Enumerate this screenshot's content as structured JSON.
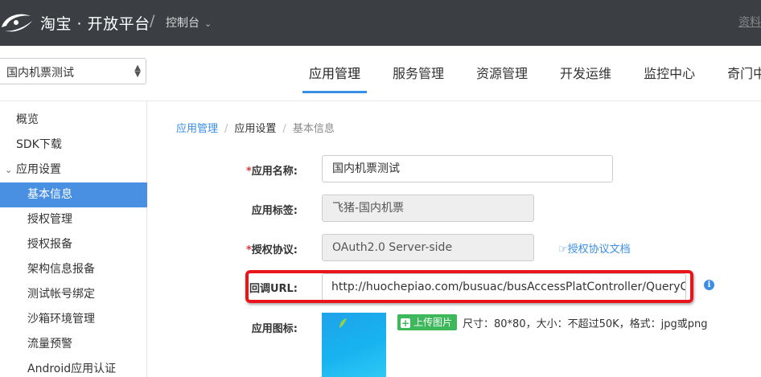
{
  "topbar": {
    "brand": "淘宝 · 开放平台",
    "separator": "/",
    "console": "控制台",
    "right_link": "资料"
  },
  "app_selector": {
    "value": "国内机票测试"
  },
  "nav": {
    "tabs": [
      {
        "label": "应用管理",
        "active": true
      },
      {
        "label": "服务管理",
        "active": false
      },
      {
        "label": "资源管理",
        "active": false
      },
      {
        "label": "开发运维",
        "active": false
      },
      {
        "label": "监控中心",
        "active": false
      },
      {
        "label": "奇门中",
        "active": false
      }
    ]
  },
  "sidebar": {
    "items": [
      {
        "label": "概览",
        "level": "top"
      },
      {
        "label": "SDK下载",
        "level": "top"
      },
      {
        "label": "应用设置",
        "level": "top",
        "expanded": true
      },
      {
        "label": "基本信息",
        "level": "sub",
        "active": true
      },
      {
        "label": "授权管理",
        "level": "sub"
      },
      {
        "label": "授权报备",
        "level": "sub"
      },
      {
        "label": "架构信息报备",
        "level": "sub"
      },
      {
        "label": "测试帐号绑定",
        "level": "sub"
      },
      {
        "label": "沙箱环境管理",
        "level": "sub"
      },
      {
        "label": "流量预警",
        "level": "sub"
      },
      {
        "label": "Android应用认证",
        "level": "sub"
      }
    ]
  },
  "breadcrumb": {
    "items": [
      "应用管理",
      "应用设置",
      "基本信息"
    ],
    "sep": "/"
  },
  "form": {
    "app_name": {
      "required_mark": "*",
      "label": "应用名称:",
      "value": "国内机票测试"
    },
    "app_tag": {
      "label": "应用标签:",
      "value": "飞猪-国内机票"
    },
    "auth_protocol": {
      "required_mark": "*",
      "label": "授权协议:",
      "value": "OAuth2.0 Server-side",
      "doc_link": "授权协议文档"
    },
    "callback_url": {
      "label": "回调URL:",
      "value": "http://huochepiao.com/busuac/busAccessPlatController/QueryCity.do",
      "info": "i"
    },
    "app_icon": {
      "label": "应用图标:",
      "upload_label": "上传图片",
      "upload_plus": "+",
      "hint": "尺寸：80*80，大小：不超过50K，格式：jpg或png"
    }
  },
  "colors": {
    "topbar_bg": "#3b3e43",
    "accent": "#3a8ee6",
    "sidebar_active": "#4a90e2",
    "highlight": "#e8161b",
    "upload_green": "#3db85a",
    "required": "#e4393c"
  },
  "icons": {
    "logo": "alibaba-logo-icon",
    "console_dropdown": "chevron-down-icon",
    "app_select": "select-arrows-icon",
    "sidebar_expand": "chevron-down-icon",
    "doc_link": "pointer-hand-icon",
    "info": "info-icon",
    "upload": "plus-icon"
  }
}
